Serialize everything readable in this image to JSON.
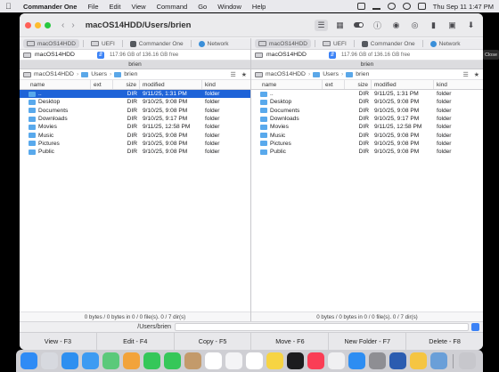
{
  "menubar": {
    "app_name": "Commander One",
    "menus": [
      "File",
      "Edit",
      "View",
      "Command",
      "Go",
      "Window",
      "Help"
    ],
    "datetime": "Thu Sep 11  1:47 PM"
  },
  "window": {
    "title": "macOS14HDD/Users/brien"
  },
  "left_pane": {
    "tabs": [
      {
        "label": "macOS14HDD",
        "icon": "disk-icon"
      },
      {
        "label": "UEFI",
        "icon": "disk-icon"
      },
      {
        "label": "Commander One",
        "icon": "app-icon"
      },
      {
        "label": "Network",
        "icon": "globe-icon"
      }
    ],
    "drive": {
      "name": "macOS14HDD",
      "free": "117.96 GB of 136.16 GB free"
    },
    "path_label": "brien",
    "breadcrumb": [
      "macOS14HDD",
      "Users",
      "brien"
    ],
    "columns": {
      "name": "name",
      "ext": "ext",
      "size": "size",
      "modified": "modified",
      "kind": "kind"
    },
    "rows": [
      {
        "name": "..",
        "ext": "",
        "size": "DIR",
        "modified": "9/11/25, 1:31 PM",
        "kind": "folder"
      },
      {
        "name": "Desktop",
        "ext": "",
        "size": "DIR",
        "modified": "9/10/25, 9:08 PM",
        "kind": "folder"
      },
      {
        "name": "Documents",
        "ext": "",
        "size": "DIR",
        "modified": "9/10/25, 9:08 PM",
        "kind": "folder"
      },
      {
        "name": "Downloads",
        "ext": "",
        "size": "DIR",
        "modified": "9/10/25, 9:17 PM",
        "kind": "folder"
      },
      {
        "name": "Movies",
        "ext": "",
        "size": "DIR",
        "modified": "9/11/25, 12:58 PM",
        "kind": "folder"
      },
      {
        "name": "Music",
        "ext": "",
        "size": "DIR",
        "modified": "9/10/25, 9:08 PM",
        "kind": "folder"
      },
      {
        "name": "Pictures",
        "ext": "",
        "size": "DIR",
        "modified": "9/10/25, 9:08 PM",
        "kind": "folder"
      },
      {
        "name": "Public",
        "ext": "",
        "size": "DIR",
        "modified": "9/10/25, 9:08 PM",
        "kind": "folder"
      }
    ],
    "status": "0 bytes / 0 bytes in 0 / 0 file(s). 0 / 7 dir(s)"
  },
  "right_pane": {
    "tabs": [
      {
        "label": "macOS14HDD",
        "icon": "disk-icon"
      },
      {
        "label": "UEFI",
        "icon": "disk-icon"
      },
      {
        "label": "Commander One",
        "icon": "app-icon"
      },
      {
        "label": "Network",
        "icon": "globe-icon"
      }
    ],
    "drive": {
      "name": "macOS14HDD",
      "free": "117.96 GB of 136.16 GB free"
    },
    "path_label": "brien",
    "breadcrumb": [
      "macOS14HDD",
      "Users",
      "brien"
    ],
    "columns": {
      "name": "name",
      "ext": "ext",
      "size": "size",
      "modified": "modified",
      "kind": "kind"
    },
    "rows": [
      {
        "name": "..",
        "ext": "",
        "size": "DIR",
        "modified": "9/11/25, 1:31 PM",
        "kind": "folder"
      },
      {
        "name": "Desktop",
        "ext": "",
        "size": "DIR",
        "modified": "9/10/25, 9:08 PM",
        "kind": "folder"
      },
      {
        "name": "Documents",
        "ext": "",
        "size": "DIR",
        "modified": "9/10/25, 9:08 PM",
        "kind": "folder"
      },
      {
        "name": "Downloads",
        "ext": "",
        "size": "DIR",
        "modified": "9/10/25, 9:17 PM",
        "kind": "folder"
      },
      {
        "name": "Movies",
        "ext": "",
        "size": "DIR",
        "modified": "9/11/25, 12:58 PM",
        "kind": "folder"
      },
      {
        "name": "Music",
        "ext": "",
        "size": "DIR",
        "modified": "9/10/25, 9:08 PM",
        "kind": "folder"
      },
      {
        "name": "Pictures",
        "ext": "",
        "size": "DIR",
        "modified": "9/10/25, 9:08 PM",
        "kind": "folder"
      },
      {
        "name": "Public",
        "ext": "",
        "size": "DIR",
        "modified": "9/10/25, 9:08 PM",
        "kind": "folder"
      }
    ],
    "status": "0 bytes / 0 bytes in 0 / 0 file(s). 0 / 7 dir(s)"
  },
  "command_line": {
    "path": "/Users/brien"
  },
  "function_keys": [
    "View - F3",
    "Edit - F4",
    "Copy - F5",
    "Move - F6",
    "New Folder - F7",
    "Delete - F8"
  ],
  "side_button": "Close",
  "dock": {
    "apps": [
      {
        "icon": "finder-icon",
        "color": "#2f8bf5"
      },
      {
        "icon": "launchpad-icon",
        "color": "#d7d9df"
      },
      {
        "icon": "safari-icon",
        "color": "#2e8ff0"
      },
      {
        "icon": "mail-icon",
        "color": "#3d9bf2"
      },
      {
        "icon": "maps-icon",
        "color": "#5bc97a"
      },
      {
        "icon": "photos-icon",
        "color": "#f2a33b"
      },
      {
        "icon": "facetime-icon",
        "color": "#35c759"
      },
      {
        "icon": "phone-icon",
        "color": "#35c759"
      },
      {
        "icon": "contacts-icon",
        "color": "#c39a6b"
      },
      {
        "icon": "calendar-icon",
        "color": "#ffffff"
      },
      {
        "icon": "reminders-icon",
        "color": "#f4f4f6"
      },
      {
        "icon": "freeform-icon",
        "color": "#ffffff"
      },
      {
        "icon": "notes-icon",
        "color": "#f7d443"
      },
      {
        "icon": "tv-icon",
        "color": "#1c1c1e"
      },
      {
        "icon": "music-icon",
        "color": "#fa3d55"
      },
      {
        "icon": "news-icon",
        "color": "#f0f0f2"
      },
      {
        "icon": "appstore-icon",
        "color": "#2d8df2"
      },
      {
        "icon": "system-settings-icon",
        "color": "#8e8e93"
      },
      {
        "icon": "commander-one-icon",
        "color": "#2b5cb0"
      },
      {
        "icon": "preview-icon",
        "color": "#f5c542"
      },
      {
        "icon": "downloads-icon",
        "color": "#6a9fd8"
      },
      {
        "icon": "trash-icon",
        "color": "#c7c7cc"
      }
    ]
  }
}
